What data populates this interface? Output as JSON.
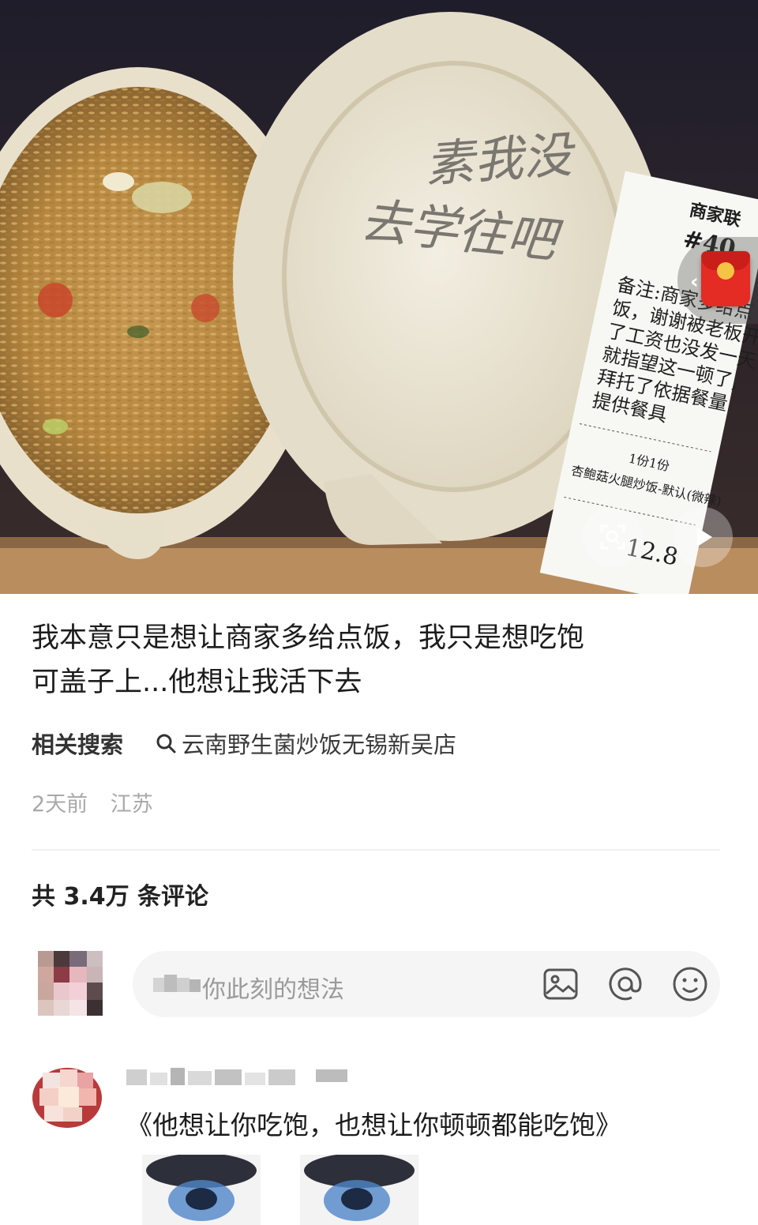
{
  "photo": {
    "lid_note_line1": "素我没",
    "lid_note_line2": "去学往吧",
    "receipt": {
      "header": "商家联",
      "order_no": "#40",
      "note_lines": [
        "备注:商家多给点",
        "饭，谢谢被老板开",
        "了工资也没发一天",
        "就指望这一顿了,",
        "拜托了依据餐量",
        "提供餐具"
      ],
      "item_count": "1份1份",
      "item": "杏鲍菇火腿炒饭-默认(微辣)",
      "price": "12.8"
    }
  },
  "post": {
    "caption_line1": "我本意只是想让商家多给点饭，我只是想吃饱",
    "caption_line2": "可盖子上...他想让我活下去",
    "related_label": "相关搜索",
    "related_query": "云南野生菌炒饭无锡新吴店",
    "time_ago": "2天前",
    "location": "江苏"
  },
  "comments": {
    "count_label": "共 3.4万 条评论",
    "input_placeholder": "你此刻的想法",
    "first_comment": "《他想让你吃饱，也想让你顿顿都能吃饱》"
  },
  "icons": {
    "search": "search-icon",
    "image": "image-icon",
    "mention": "at-icon",
    "emoji": "smiley-icon",
    "red_packet": "red-packet-icon",
    "scan": "scan-icon",
    "play": "play-icon",
    "back": "chevron-left-icon"
  },
  "colors": {
    "accent_red": "#e42b24",
    "muted_text": "#a9a9a9",
    "input_bg": "#f5f5f5"
  }
}
